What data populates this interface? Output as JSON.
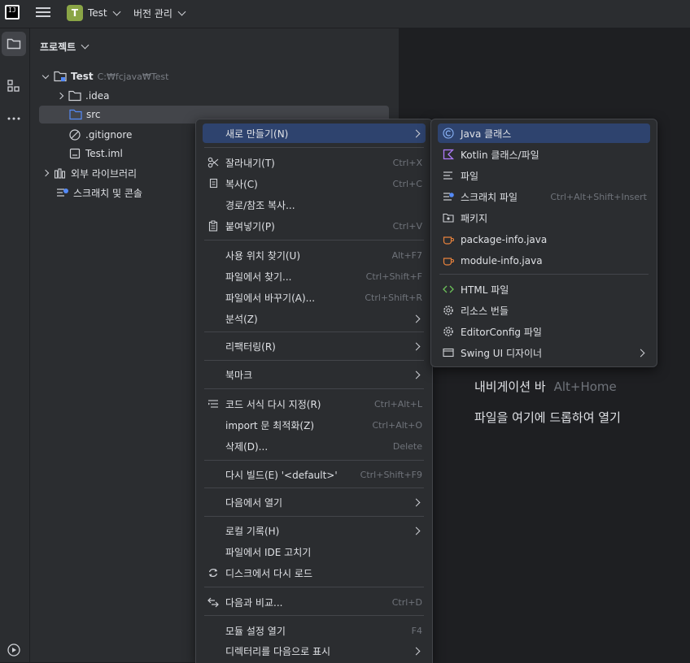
{
  "titlebar": {
    "app_logo_text": "IJ",
    "project_badge": "T",
    "project_name": "Test",
    "vcs_label": "버전 관리"
  },
  "project_panel": {
    "title": "프로젝트",
    "tree": [
      {
        "label": "Test",
        "path": "C:₩fcjava₩Test",
        "icon": "module-folder-icon"
      },
      {
        "label": ".idea",
        "icon": "folder-icon"
      },
      {
        "label": "src",
        "icon": "source-folder-icon"
      },
      {
        "label": ".gitignore",
        "icon": "ignore-file-icon"
      },
      {
        "label": "Test.iml",
        "icon": "iml-file-icon"
      },
      {
        "label": "외부 라이브러리",
        "icon": "library-icon"
      },
      {
        "label": "스크래치 및 콘솔",
        "icon": "scratch-icon"
      }
    ]
  },
  "context_menu": {
    "items": [
      {
        "label": "새로 만들기(N)",
        "shortcut": "",
        "submenu": true,
        "highlighted": true
      },
      {
        "label": "잘라내기(T)",
        "shortcut": "Ctrl+X",
        "icon": "cut-icon"
      },
      {
        "label": "복사(C)",
        "shortcut": "Ctrl+C",
        "icon": "copy-icon"
      },
      {
        "label": "경로/참조 복사...",
        "shortcut": ""
      },
      {
        "label": "붙여넣기(P)",
        "shortcut": "Ctrl+V",
        "icon": "paste-icon"
      },
      {
        "label": "사용 위치 찾기(U)",
        "shortcut": "Alt+F7"
      },
      {
        "label": "파일에서 찾기...",
        "shortcut": "Ctrl+Shift+F"
      },
      {
        "label": "파일에서 바꾸기(A)...",
        "shortcut": "Ctrl+Shift+R"
      },
      {
        "label": "분석(Z)",
        "shortcut": "",
        "submenu": true
      },
      {
        "label": "리팩터링(R)",
        "shortcut": "",
        "submenu": true
      },
      {
        "label": "북마크",
        "shortcut": "",
        "submenu": true
      },
      {
        "label": "코드 서식 다시 지정(R)",
        "shortcut": "Ctrl+Alt+L",
        "icon": "reformat-icon"
      },
      {
        "label": "import 문 최적화(Z)",
        "shortcut": "Ctrl+Alt+O"
      },
      {
        "label": "삭제(D)...",
        "shortcut": "Delete"
      },
      {
        "label": "다시 빌드(E) '<default>'",
        "shortcut": "Ctrl+Shift+F9"
      },
      {
        "label": "다음에서 열기",
        "shortcut": "",
        "submenu": true
      },
      {
        "label": "로컬 기록(H)",
        "shortcut": "",
        "submenu": true
      },
      {
        "label": "파일에서 IDE 고치기",
        "shortcut": ""
      },
      {
        "label": "디스크에서 다시 로드",
        "shortcut": "",
        "icon": "reload-icon"
      },
      {
        "label": "다음과 비교...",
        "shortcut": "Ctrl+D",
        "icon": "compare-icon"
      },
      {
        "label": "모듈 설정 열기",
        "shortcut": "F4"
      },
      {
        "label": "디렉터리를 다음으로 표시",
        "shortcut": "",
        "submenu": true
      }
    ]
  },
  "new_submenu": {
    "items": [
      {
        "label": "Java 클래스",
        "shortcut": "",
        "icon": "java-class-icon",
        "highlighted": true
      },
      {
        "label": "Kotlin 클래스/파일",
        "shortcut": "",
        "icon": "kotlin-icon"
      },
      {
        "label": "파일",
        "shortcut": "",
        "icon": "text-file-icon"
      },
      {
        "label": "스크래치 파일",
        "shortcut": "Ctrl+Alt+Shift+Insert",
        "icon": "scratch-file-icon"
      },
      {
        "label": "패키지",
        "shortcut": "",
        "icon": "package-icon"
      },
      {
        "label": "package-info.java",
        "shortcut": "",
        "icon": "java-cup-icon"
      },
      {
        "label": "module-info.java",
        "shortcut": "",
        "icon": "java-cup-icon"
      },
      {
        "label": "HTML 파일",
        "shortcut": "",
        "icon": "html-icon"
      },
      {
        "label": "리소스 번들",
        "shortcut": "",
        "icon": "gear-icon"
      },
      {
        "label": "EditorConfig 파일",
        "shortcut": "",
        "icon": "gear-icon"
      },
      {
        "label": "Swing UI 디자이너",
        "shortcut": "",
        "icon": "window-icon",
        "submenu": true
      }
    ]
  },
  "editor": {
    "hint_nav": "내비게이션 바",
    "hint_nav_key": "Alt+Home",
    "hint_drop": "파일을 여기에 드롭하여 열기"
  },
  "colors": {
    "background": "#1e1f22",
    "panel": "#2b2d30",
    "selection": "#43454a",
    "menu_highlight": "#2e436e",
    "accent_blue": "#548af7",
    "badge_green": "#8aa546"
  }
}
